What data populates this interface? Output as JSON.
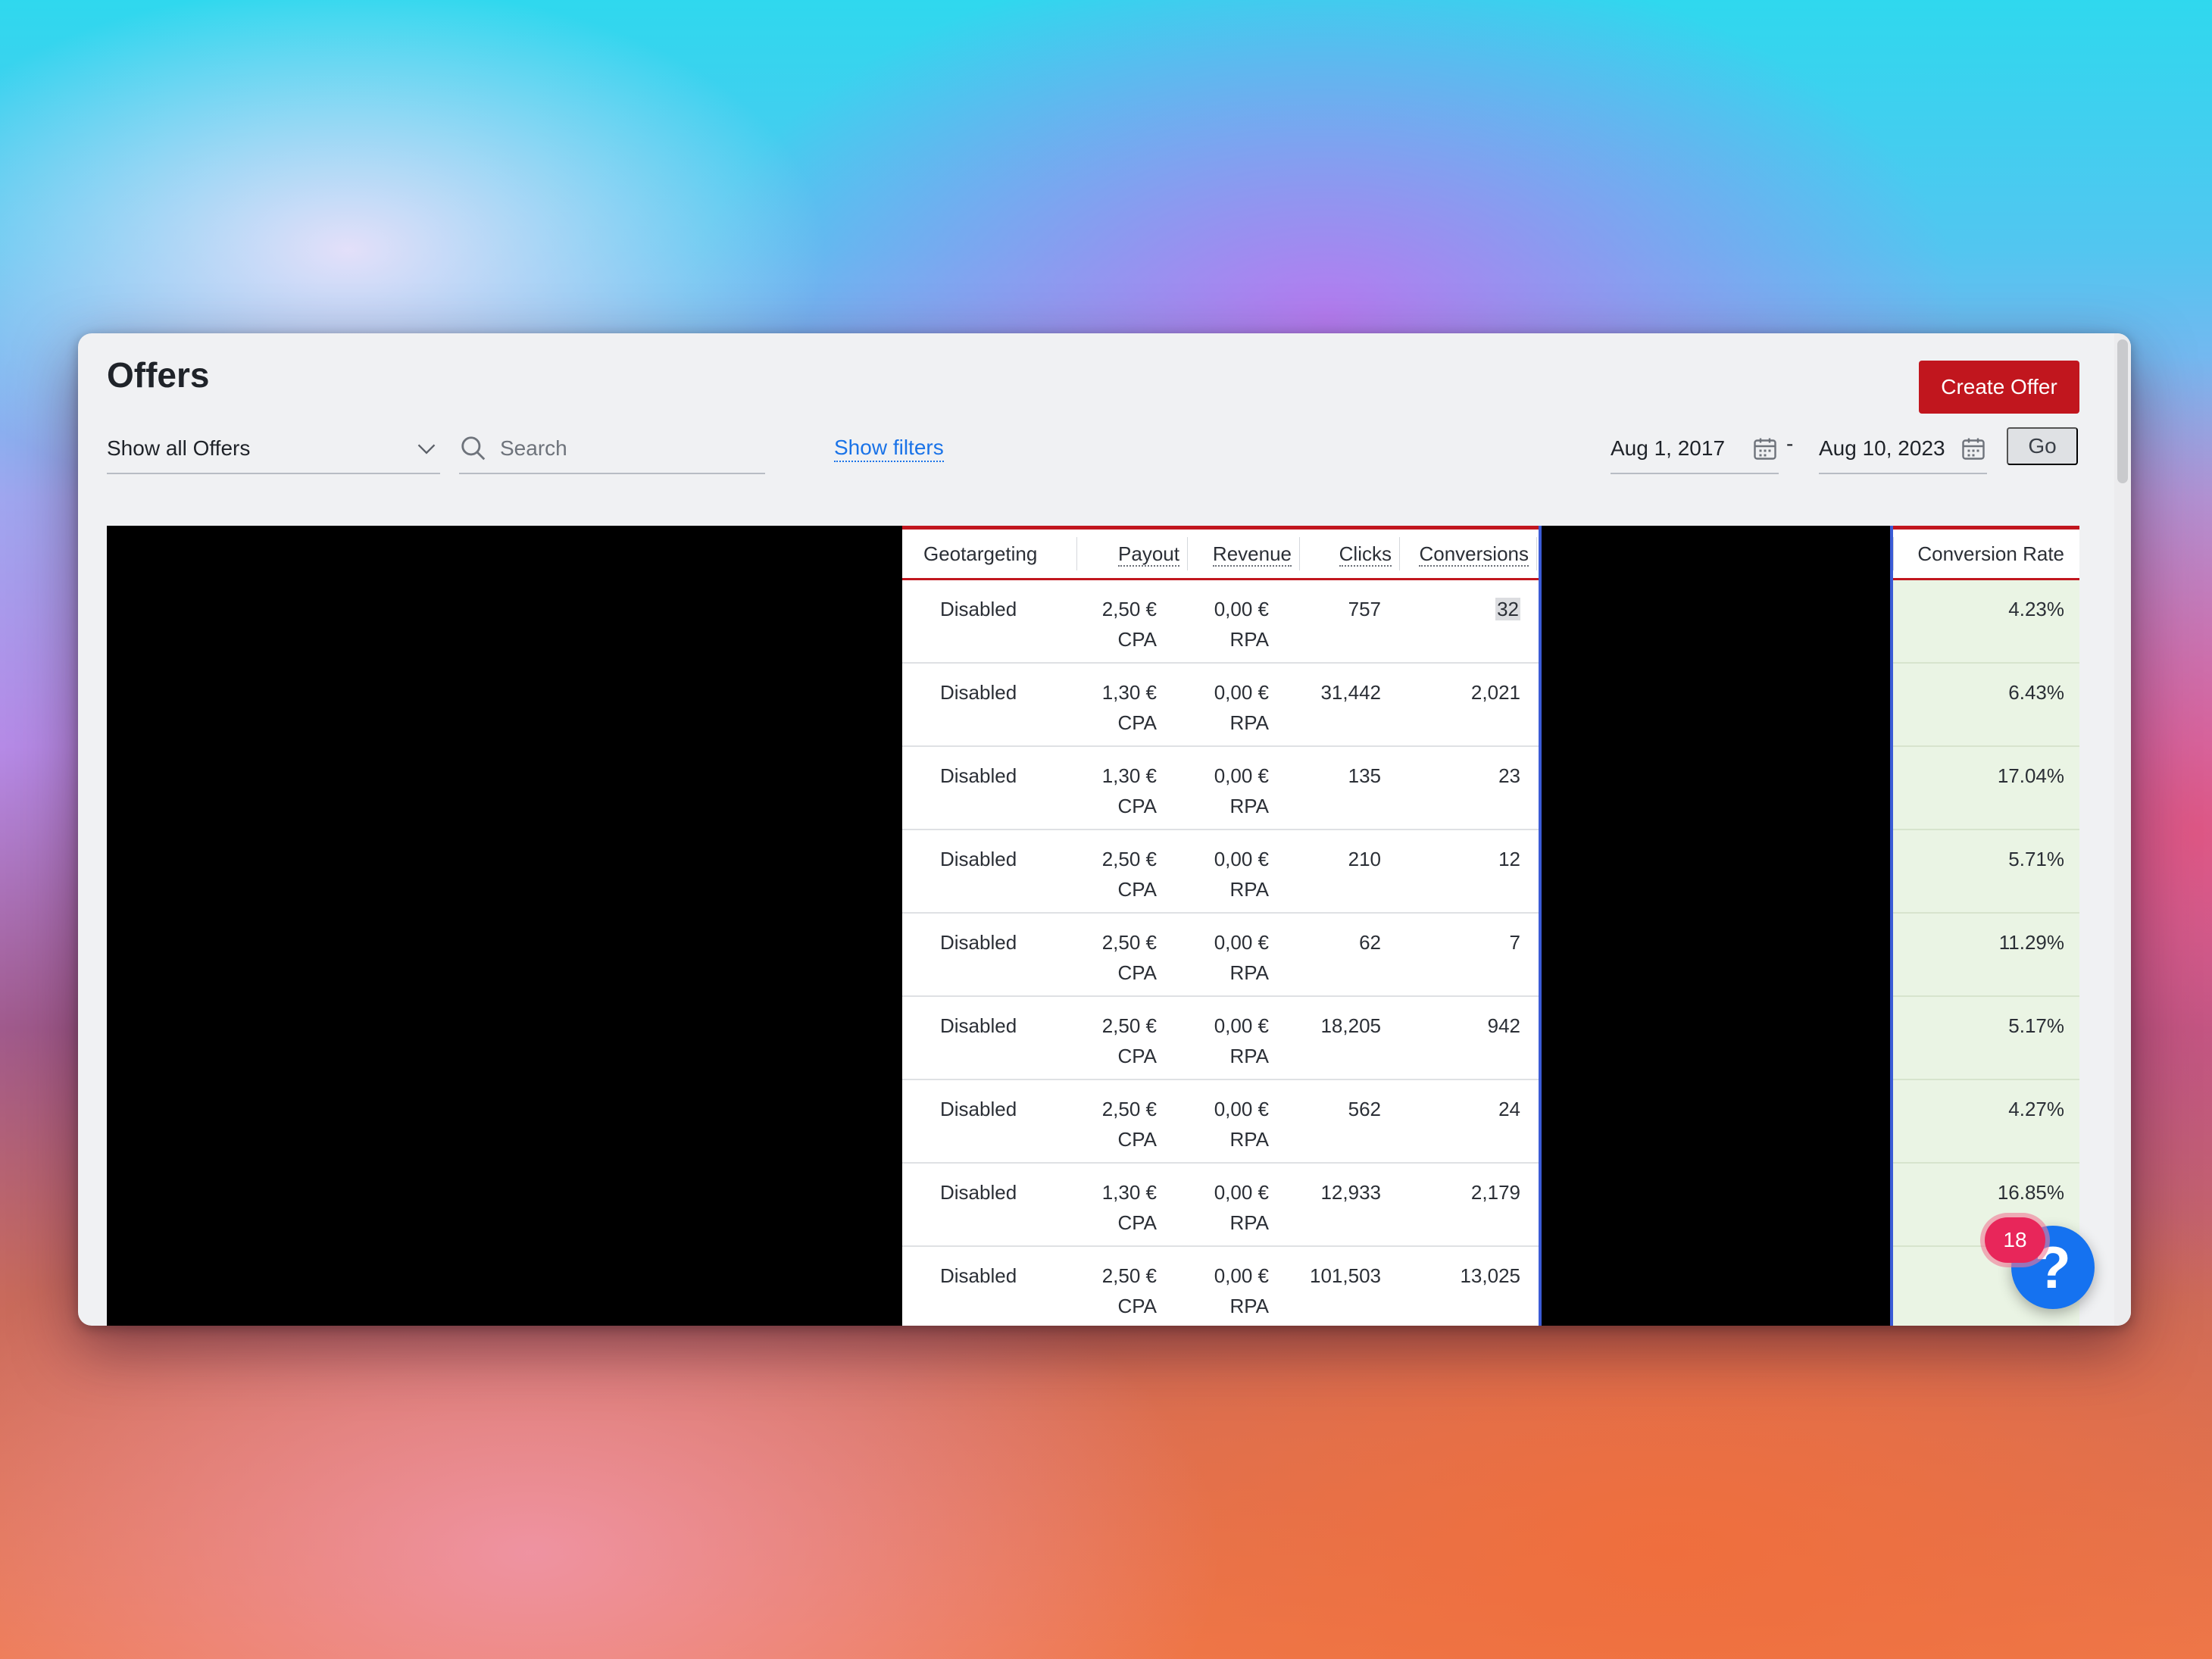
{
  "page": {
    "title": "Offers"
  },
  "actions": {
    "create_offer": "Create Offer",
    "go": "Go",
    "show_filters": "Show filters"
  },
  "filters": {
    "offer_select": "Show all Offers",
    "search_placeholder": "Search",
    "date_from": "Aug 1, 2017",
    "date_separator": "-",
    "date_to": "Aug 10, 2023"
  },
  "table": {
    "columns": [
      "Geotargeting",
      "Payout",
      "Revenue",
      "Clicks",
      "Conversions",
      "Conversion Rate"
    ],
    "rows": [
      {
        "geotargeting": "Disabled",
        "payout": "2,50 €",
        "payout_type": "CPA",
        "revenue": "0,00 €",
        "revenue_type": "RPA",
        "clicks": "757",
        "conversions": "32",
        "conversion_rate": "4.23%"
      },
      {
        "geotargeting": "Disabled",
        "payout": "1,30 €",
        "payout_type": "CPA",
        "revenue": "0,00 €",
        "revenue_type": "RPA",
        "clicks": "31,442",
        "conversions": "2,021",
        "conversion_rate": "6.43%"
      },
      {
        "geotargeting": "Disabled",
        "payout": "1,30 €",
        "payout_type": "CPA",
        "revenue": "0,00 €",
        "revenue_type": "RPA",
        "clicks": "135",
        "conversions": "23",
        "conversion_rate": "17.04%"
      },
      {
        "geotargeting": "Disabled",
        "payout": "2,50 €",
        "payout_type": "CPA",
        "revenue": "0,00 €",
        "revenue_type": "RPA",
        "clicks": "210",
        "conversions": "12",
        "conversion_rate": "5.71%"
      },
      {
        "geotargeting": "Disabled",
        "payout": "2,50 €",
        "payout_type": "CPA",
        "revenue": "0,00 €",
        "revenue_type": "RPA",
        "clicks": "62",
        "conversions": "7",
        "conversion_rate": "11.29%"
      },
      {
        "geotargeting": "Disabled",
        "payout": "2,50 €",
        "payout_type": "CPA",
        "revenue": "0,00 €",
        "revenue_type": "RPA",
        "clicks": "18,205",
        "conversions": "942",
        "conversion_rate": "5.17%"
      },
      {
        "geotargeting": "Disabled",
        "payout": "2,50 €",
        "payout_type": "CPA",
        "revenue": "0,00 €",
        "revenue_type": "RPA",
        "clicks": "562",
        "conversions": "24",
        "conversion_rate": "4.27%"
      },
      {
        "geotargeting": "Disabled",
        "payout": "1,30 €",
        "payout_type": "CPA",
        "revenue": "0,00 €",
        "revenue_type": "RPA",
        "clicks": "12,933",
        "conversions": "2,179",
        "conversion_rate": "16.85%"
      },
      {
        "geotargeting": "Disabled",
        "payout": "2,50 €",
        "payout_type": "CPA",
        "revenue": "0,00 €",
        "revenue_type": "RPA",
        "clicks": "101,503",
        "conversions": "13,025",
        "conversion_rate": ""
      }
    ]
  },
  "help": {
    "icon": "question-icon",
    "glyph": "?",
    "badge_count": "18"
  },
  "colors": {
    "brand_red": "#c1161e",
    "link_blue": "#1a73e8",
    "help_blue": "#1572f0",
    "badge_pink": "#e8265a",
    "highlight_green": "#eaf4e4"
  }
}
